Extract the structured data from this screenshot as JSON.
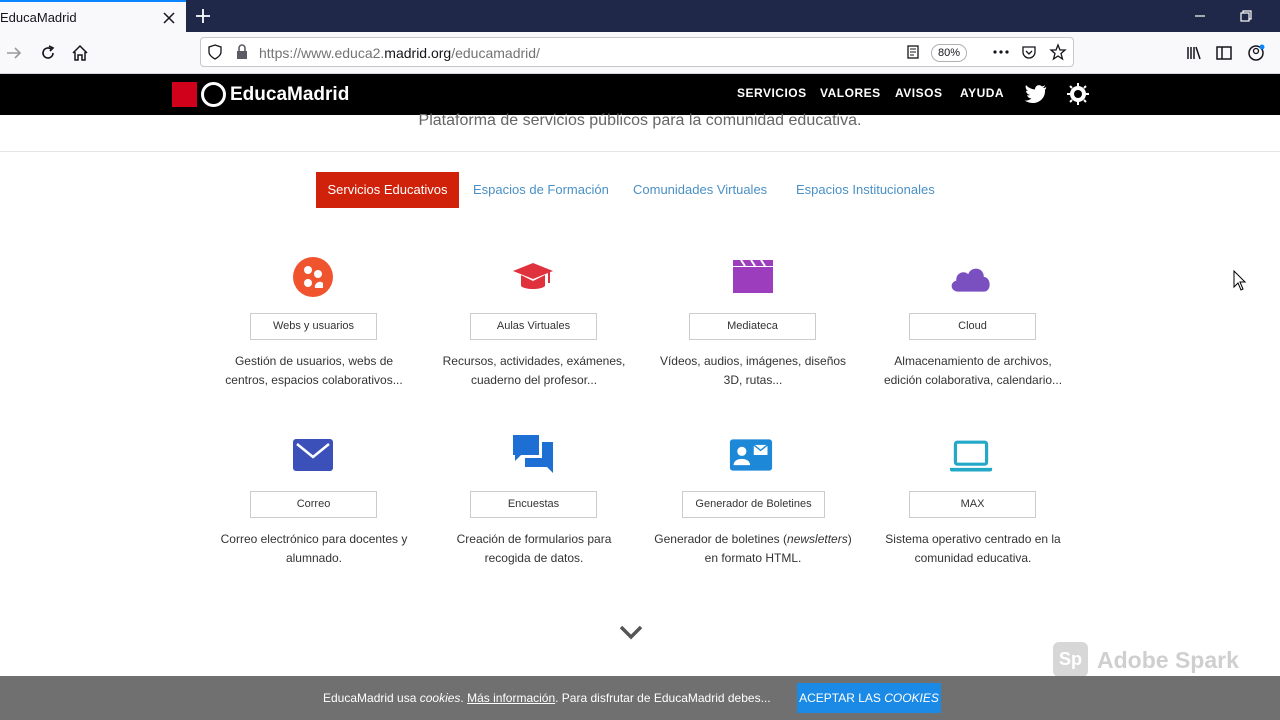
{
  "browser": {
    "tab_title": "EducaMadrid",
    "url_host_prefix": "https://www.educa2.",
    "url_host_main": "madrid.org",
    "url_path": "/educamadrid/",
    "zoom": "80%"
  },
  "site": {
    "logo_text": "EducaMadrid",
    "nav": [
      "SERVICIOS",
      "VALORES",
      "AVISOS",
      "AYUDA"
    ],
    "subtitle": "Plataforma de servicios públicos para la comunidad educativa."
  },
  "tabs": [
    "Servicios Educativos",
    "Espacios de Formación",
    "Comunidades Virtuales",
    "Espacios Institucionales"
  ],
  "cards": [
    {
      "label": "Webs y usuarios",
      "desc1": "Gestión de usuarios, webs de",
      "desc2": "centros, espacios colaborativos...",
      "icon": "users-icon",
      "color": "#f0542f"
    },
    {
      "label": "Aulas Virtuales",
      "desc1": "Recursos, actividades, exámenes,",
      "desc2": "cuaderno del profesor...",
      "icon": "graduation-cap-icon",
      "color": "#e0323c"
    },
    {
      "label": "Mediateca",
      "desc1": "Vídeos, audios, imágenes, diseños",
      "desc2": "3D, rutas...",
      "icon": "clapperboard-icon",
      "color": "#9b3dbd"
    },
    {
      "label": "Cloud",
      "desc1": "Almacenamiento de archivos,",
      "desc2": "edición colaborativa, calendario...",
      "icon": "cloud-icon",
      "color": "#7a4fc0"
    },
    {
      "label": "Correo",
      "desc1": "Correo electrónico para docentes y",
      "desc2": "alumnado.",
      "icon": "envelope-icon",
      "color": "#3b50b8"
    },
    {
      "label": "Encuestas",
      "desc1": "Creación de formularios para",
      "desc2": "recogida de datos.",
      "icon": "chat-bubbles-icon",
      "color": "#1e6fd4"
    },
    {
      "label": "Generador de Boletines",
      "desc1a": "Generador de boletines (",
      "desc1i": "newsletters",
      "desc1b": ")",
      "desc2": "en formato HTML.",
      "icon": "contact-card-icon",
      "color": "#1e88d8"
    },
    {
      "label": "MAX",
      "desc1": "Sistema operativo centrado en la",
      "desc2": "comunidad educativa.",
      "icon": "laptop-icon",
      "color": "#23a8c8"
    }
  ],
  "watermark": {
    "badge": "Sp",
    "text": "Adobe Spark"
  },
  "cookie": {
    "text1": "EducaMadrid usa ",
    "text1_italic": "cookies",
    "text2": ". ",
    "link": "Más información",
    "text3": ". Para disfrutar de EducaMadrid debes...",
    "button_prefix": "ACEPTAR LAS ",
    "button_italic": "COOKIES"
  },
  "colors": {
    "accent_red": "#d0220a",
    "tab_link": "#4a90c6",
    "cookie_button": "#1a8ae6"
  }
}
